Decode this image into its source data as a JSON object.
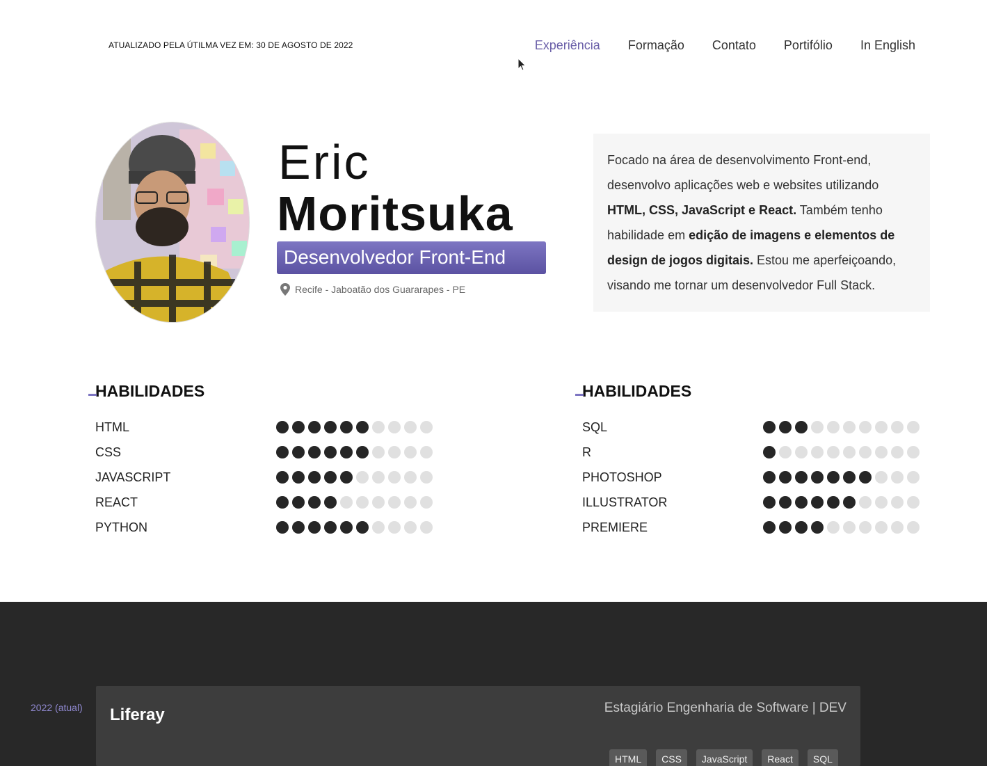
{
  "header": {
    "updated": "ATUALIZADO PELA ÚTILMA VEZ EM: 30 DE AGOSTO DE 2022",
    "nav": [
      {
        "label": "Experiência",
        "active": true
      },
      {
        "label": "Formação",
        "active": false
      },
      {
        "label": "Contato",
        "active": false
      },
      {
        "label": "Portifólio",
        "active": false
      },
      {
        "label": "In English",
        "active": false
      }
    ]
  },
  "profile": {
    "first_name": "Eric",
    "last_name": "Moritsuka",
    "role": "Desenvolvedor Front-End",
    "location": "Recife - Jaboatão dos Guararapes - PE",
    "summary": [
      {
        "text": "Focado na área de desenvolvimento Front-end, desenvolvo aplicações web e websites utilizando ",
        "bold": false
      },
      {
        "text": "HTML, CSS, JavaScript e React.",
        "bold": true
      },
      {
        "text": " Também tenho habilidade em ",
        "bold": false
      },
      {
        "text": "edição de imagens e elementos de design de jogos digitais.",
        "bold": true
      },
      {
        "text": " Estou me aperfeiçoando, visando me tornar um desenvolvedor Full Stack.",
        "bold": false
      }
    ]
  },
  "skills": {
    "left": {
      "title": "HABILIDADES",
      "items": [
        {
          "name": "HTML",
          "level": 6,
          "max": 10
        },
        {
          "name": "CSS",
          "level": 6,
          "max": 10
        },
        {
          "name": "JAVASCRIPT",
          "level": 5,
          "max": 10
        },
        {
          "name": "REACT",
          "level": 4,
          "max": 10
        },
        {
          "name": "PYTHON",
          "level": 6,
          "max": 10
        }
      ]
    },
    "right": {
      "title": "HABILIDADES",
      "items": [
        {
          "name": "SQL",
          "level": 3,
          "max": 10
        },
        {
          "name": "R",
          "level": 1,
          "max": 10
        },
        {
          "name": "PHOTOSHOP",
          "level": 7,
          "max": 10
        },
        {
          "name": "ILLUSTRATOR",
          "level": 6,
          "max": 10
        },
        {
          "name": "PREMIERE",
          "level": 4,
          "max": 10
        }
      ]
    }
  },
  "experience": {
    "year": "2022 (atual)",
    "company": "Liferay",
    "position": "Estagiário Engenharia de Software | DEV",
    "tags": [
      "HTML",
      "CSS",
      "JavaScript",
      "React",
      "SQL"
    ]
  },
  "colors": {
    "accent": "#6a5fa8",
    "dark_bg": "#282828",
    "card_bg": "#3d3d3d"
  }
}
